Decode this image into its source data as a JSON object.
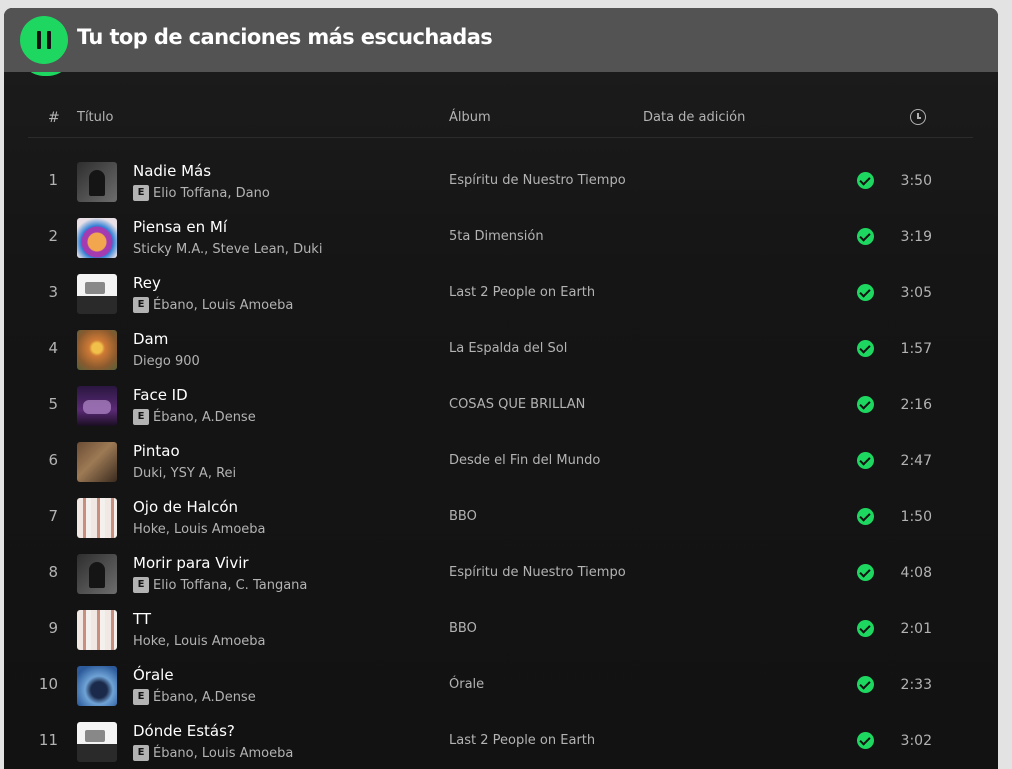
{
  "header": {
    "title": "Tu top de canciones más escuchadas",
    "play_state": "playing"
  },
  "columns": {
    "number": "#",
    "title": "Título",
    "album": "Álbum",
    "date_added": "Data de adición",
    "duration_icon": "clock-icon"
  },
  "tracks": [
    {
      "n": "1",
      "title": "Nadie Más",
      "explicit": true,
      "artists": "Elio Toffana, Dano",
      "album": "Espíritu de Nuestro Tiempo",
      "saved": true,
      "duration": "3:50"
    },
    {
      "n": "2",
      "title": "Piensa en Mí",
      "explicit": false,
      "artists": "Sticky M.A., Steve Lean, Duki",
      "album": "5ta Dimensión",
      "saved": true,
      "duration": "3:19"
    },
    {
      "n": "3",
      "title": "Rey",
      "explicit": true,
      "artists": "Ébano, Louis Amoeba",
      "album": "Last 2 People on Earth",
      "saved": true,
      "duration": "3:05"
    },
    {
      "n": "4",
      "title": "Dam",
      "explicit": false,
      "artists": "Diego 900",
      "album": "La Espalda del Sol",
      "saved": true,
      "duration": "1:57"
    },
    {
      "n": "5",
      "title": "Face ID",
      "explicit": true,
      "artists": "Ébano, A.Dense",
      "album": "COSAS QUE BRILLAN",
      "saved": true,
      "duration": "2:16"
    },
    {
      "n": "6",
      "title": "Pintao",
      "explicit": false,
      "artists": "Duki, YSY A, Rei",
      "album": "Desde el Fin del Mundo",
      "saved": true,
      "duration": "2:47"
    },
    {
      "n": "7",
      "title": "Ojo de Halcón",
      "explicit": false,
      "artists": "Hoke, Louis Amoeba",
      "album": "BBO",
      "saved": true,
      "duration": "1:50"
    },
    {
      "n": "8",
      "title": "Morir para Vivir",
      "explicit": true,
      "artists": "Elio Toffana, C. Tangana",
      "album": "Espíritu de Nuestro Tiempo",
      "saved": true,
      "duration": "4:08"
    },
    {
      "n": "9",
      "title": "TT",
      "explicit": false,
      "artists": "Hoke, Louis Amoeba",
      "album": "BBO",
      "saved": true,
      "duration": "2:01"
    },
    {
      "n": "10",
      "title": "Órale",
      "explicit": true,
      "artists": "Ébano, A.Dense",
      "album": "Órale",
      "saved": true,
      "duration": "2:33"
    },
    {
      "n": "11",
      "title": "Dónde Estás?",
      "explicit": true,
      "artists": "Ébano, Louis Amoeba",
      "album": "Last 2 People on Earth",
      "saved": true,
      "duration": "3:02"
    }
  ],
  "explicit_badge": "E",
  "colors": {
    "accent": "#1ed760",
    "background": "#121212",
    "topbar": "#535353",
    "text_primary": "#ffffff",
    "text_secondary": "#b3b3b3"
  }
}
